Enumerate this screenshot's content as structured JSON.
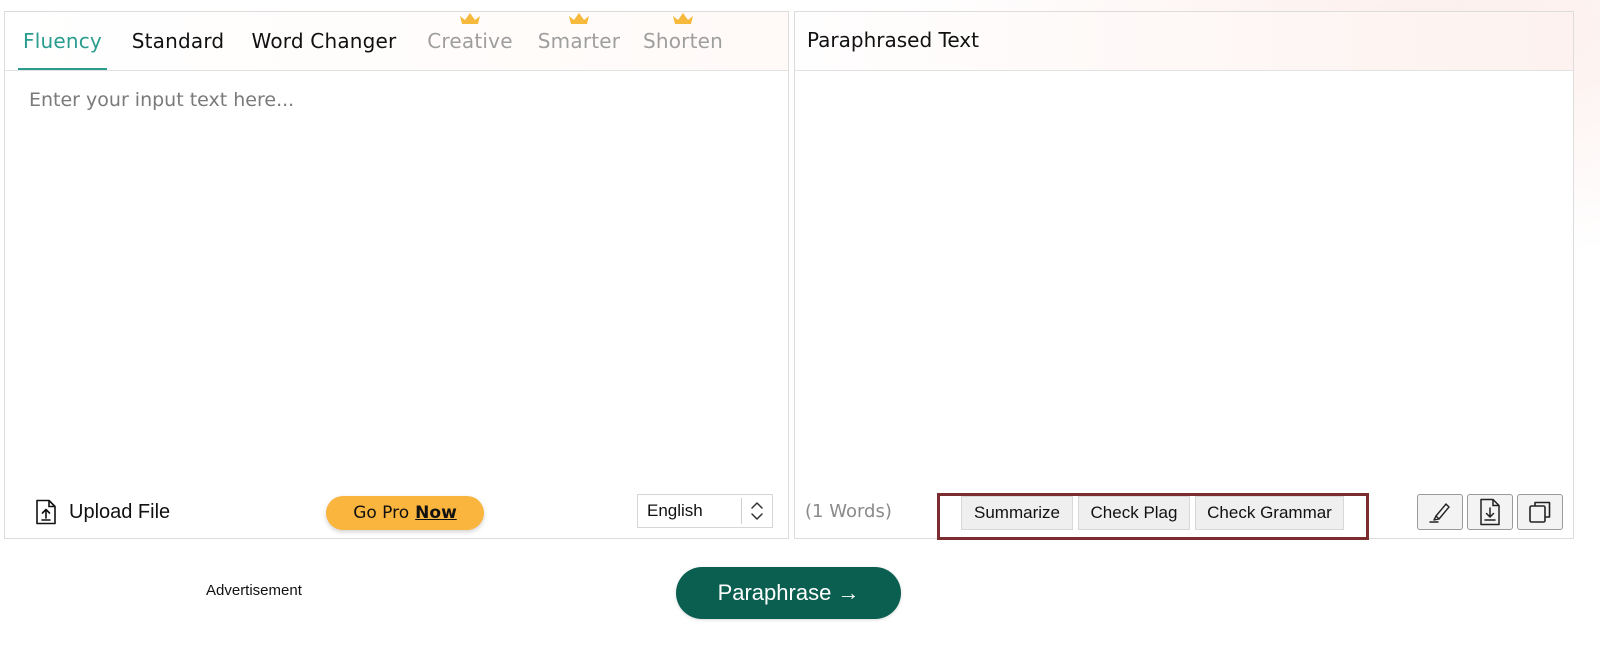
{
  "tabs": [
    {
      "label": "Fluency",
      "state": "active",
      "pro": false
    },
    {
      "label": "Standard",
      "state": "normal",
      "pro": false
    },
    {
      "label": "Word Changer",
      "state": "normal",
      "pro": false
    },
    {
      "label": "Creative",
      "state": "locked",
      "pro": true
    },
    {
      "label": "Smarter",
      "state": "locked",
      "pro": true
    },
    {
      "label": "Shorten",
      "state": "locked",
      "pro": true
    }
  ],
  "input": {
    "placeholder": "Enter your input text here...",
    "value": ""
  },
  "upload": {
    "label": "Upload File",
    "icon": "file-upload-icon"
  },
  "gopro": {
    "text": "Go Pro",
    "emphasis": "Now"
  },
  "language": {
    "selected": "English",
    "icon": "up-down-chevron-icon"
  },
  "output": {
    "title": "Paraphrased Text",
    "word_count": "(1 Words)"
  },
  "tools": {
    "summarize": "Summarize",
    "check_plag": "Check Plag",
    "check_grammar": "Check Grammar"
  },
  "icons": {
    "highlighter": "highlighter-icon",
    "download": "download-file-icon",
    "copy": "copy-icon"
  },
  "advertisement": "Advertisement",
  "paraphrase_button": "Paraphrase →",
  "colors": {
    "accent": "#2a9d8f",
    "gopro": "#f9b53e",
    "primary_button": "#0b5f51",
    "highlight_border": "#7b2c2f",
    "crown": "#f6b93b"
  }
}
